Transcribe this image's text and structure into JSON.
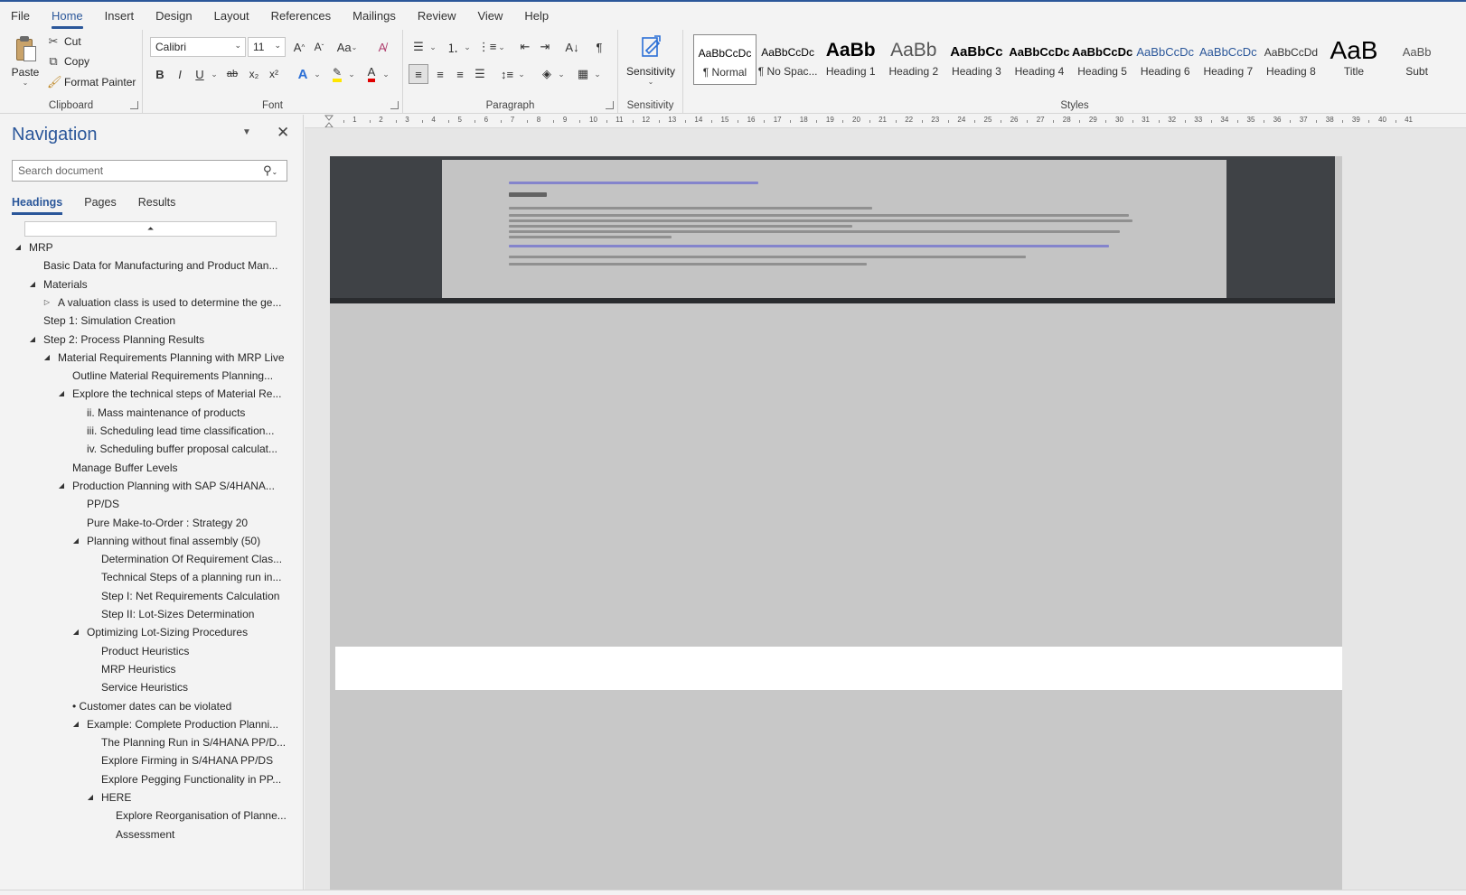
{
  "menu": [
    "File",
    "Home",
    "Insert",
    "Design",
    "Layout",
    "References",
    "Mailings",
    "Review",
    "View",
    "Help"
  ],
  "active_menu": "Home",
  "clipboard": {
    "paste": "Paste",
    "cut": "Cut",
    "copy": "Copy",
    "format_painter": "Format Painter",
    "label": "Clipboard"
  },
  "font": {
    "name": "Calibri",
    "size": "11",
    "label": "Font",
    "change_case": "Aa",
    "bold": "B",
    "italic": "I",
    "underline": "U",
    "strike": "ab",
    "subscript": "x₂",
    "superscript": "x²"
  },
  "paragraph": {
    "label": "Paragraph",
    "pilcrow": "¶"
  },
  "sensitivity": {
    "button": "Sensitivity",
    "label": "Sensitivity"
  },
  "styles": {
    "label": "Styles",
    "items": [
      {
        "preview": "AaBbCcDc",
        "name": "¶ Normal"
      },
      {
        "preview": "AaBbCcDc",
        "name": "¶ No Spac..."
      },
      {
        "preview": "AaBb",
        "name": "Heading 1"
      },
      {
        "preview": "AaBb",
        "name": "Heading 2"
      },
      {
        "preview": "AaBbCc",
        "name": "Heading 3"
      },
      {
        "preview": "AaBbCcDc",
        "name": "Heading 4"
      },
      {
        "preview": "AaBbCcDc",
        "name": "Heading 5"
      },
      {
        "preview": "AaBbCcDc",
        "name": "Heading 6"
      },
      {
        "preview": "AaBbCcDc",
        "name": "Heading 7"
      },
      {
        "preview": "AaBbCcDd",
        "name": "Heading 8"
      },
      {
        "preview": "AaB",
        "name": "Title"
      },
      {
        "preview": "AaBb",
        "name": "Subt"
      }
    ]
  },
  "navigation": {
    "title": "Navigation",
    "search_placeholder": "Search document",
    "tabs": [
      "Headings",
      "Pages",
      "Results"
    ],
    "active_tab": "Headings",
    "tree": [
      {
        "text": "MRP",
        "level": 0,
        "toggle": "open"
      },
      {
        "text": "Basic Data for Manufacturing and Product Man...",
        "level": 1,
        "toggle": "none"
      },
      {
        "text": "Materials",
        "level": 1,
        "toggle": "open"
      },
      {
        "text": "A valuation class is used to determine the ge...",
        "level": 2,
        "toggle": "closed"
      },
      {
        "text": "Step 1: Simulation Creation",
        "level": 1,
        "toggle": "none"
      },
      {
        "text": "Step 2: Process Planning Results",
        "level": 1,
        "toggle": "open"
      },
      {
        "text": "Material Requirements Planning with MRP Live",
        "level": 2,
        "toggle": "open"
      },
      {
        "text": "Outline Material Requirements Planning...",
        "level": 3,
        "toggle": "none"
      },
      {
        "text": "Explore the technical steps of Material Re...",
        "level": 3,
        "toggle": "open"
      },
      {
        "text": "ii.  Mass maintenance of products",
        "level": 4,
        "toggle": "none"
      },
      {
        "text": "iii.  Scheduling lead time classification...",
        "level": 4,
        "toggle": "none"
      },
      {
        "text": "iv.  Scheduling buffer proposal calculat...",
        "level": 4,
        "toggle": "none"
      },
      {
        "text": "Manage Buffer Levels",
        "level": 3,
        "toggle": "none"
      },
      {
        "text": "Production Planning with SAP S/4HANA...",
        "level": 3,
        "toggle": "open"
      },
      {
        "text": "PP/DS",
        "level": 4,
        "toggle": "none"
      },
      {
        "text": "Pure Make-to-Order : Strategy 20",
        "level": 4,
        "toggle": "none"
      },
      {
        "text": "Planning without final assembly (50)",
        "level": 4,
        "toggle": "open"
      },
      {
        "text": "Determination Of Requirement Clas...",
        "level": 5,
        "toggle": "none"
      },
      {
        "text": "Technical Steps of a planning run in...",
        "level": 5,
        "toggle": "none"
      },
      {
        "text": "Step I: Net Requirements Calculation",
        "level": 5,
        "toggle": "none"
      },
      {
        "text": "Step II: Lot-Sizes Determination",
        "level": 5,
        "toggle": "none"
      },
      {
        "text": "Optimizing Lot-Sizing Procedures",
        "level": 4,
        "toggle": "open"
      },
      {
        "text": "Product Heuristics",
        "level": 5,
        "toggle": "none"
      },
      {
        "text": "MRP Heuristics",
        "level": 5,
        "toggle": "none"
      },
      {
        "text": "Service Heuristics",
        "level": 5,
        "toggle": "none"
      },
      {
        "text": "•  Customer dates can be violated",
        "level": 4,
        "toggle": "none",
        "bullet": true
      },
      {
        "text": "Example: Complete Production Planni...",
        "level": 4,
        "toggle": "open"
      },
      {
        "text": "The Planning Run in S/4HANA PP/D...",
        "level": 5,
        "toggle": "none"
      },
      {
        "text": "Explore Firming in S/4HANA PP/DS",
        "level": 5,
        "toggle": "none"
      },
      {
        "text": "Explore Pegging Functionality in PP...",
        "level": 5,
        "toggle": "none"
      },
      {
        "text": "HERE",
        "level": 5,
        "toggle": "open"
      },
      {
        "text": "Explore Reorganisation of Planne...",
        "level": 6,
        "toggle": "none"
      },
      {
        "text": "Assessment",
        "level": 6,
        "toggle": "none"
      }
    ]
  },
  "ruler": {
    "numbers": [
      1,
      2,
      3,
      4,
      5,
      6,
      7,
      8,
      9,
      10,
      11,
      12,
      13,
      14,
      15,
      16,
      17,
      18,
      19,
      20,
      21,
      22,
      23,
      24,
      25,
      26,
      27,
      28,
      29,
      30,
      31,
      32,
      33,
      34,
      35,
      36,
      37,
      38,
      39,
      40,
      41
    ]
  },
  "colors": {
    "accent": "#2b579a",
    "highlight": "#ffe600",
    "font_color": "#e00000",
    "page_gray": "#c8c8c8"
  }
}
